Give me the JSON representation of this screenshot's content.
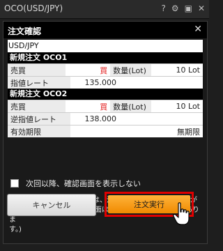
{
  "window": {
    "title": "OCO(USD/JPY)",
    "controls": [
      "?",
      "⚙",
      "▣",
      "✕"
    ]
  },
  "dialog": {
    "title": "注文確認",
    "close": "✕",
    "pair": "USD/JPY",
    "oco1": {
      "title": "新規注文 OCO1",
      "side_label": "売買",
      "side_value": "買",
      "qty_label": "数量(Lot)",
      "qty_value": "10 Lot",
      "price_label": "指値レート",
      "price_value": "135.000"
    },
    "oco2": {
      "title": "新規注文 OCO2",
      "side_label": "売買",
      "side_value": "買",
      "qty_label": "数量(Lot)",
      "qty_value": "10 Lot",
      "price_label": "逆指値レート",
      "price_value": "138.000",
      "expiry_label": "有効期限",
      "expiry_value": "無期限"
    },
    "checkbox_label": "次回以降、確認画面を表示しない",
    "note_line1": "確認画面を再表示させるには、注文共通設定画面で再設定が",
    "note_line2": "必要です。(注文共通設定画面は設定・その他メニューにありま",
    "note_line3": "す。)",
    "cancel_label": "キャンセル",
    "execute_label": "注文実行"
  },
  "colors": {
    "buy": "#e21c1c",
    "execute_button": "#f39a12",
    "highlight": "#e00000"
  }
}
